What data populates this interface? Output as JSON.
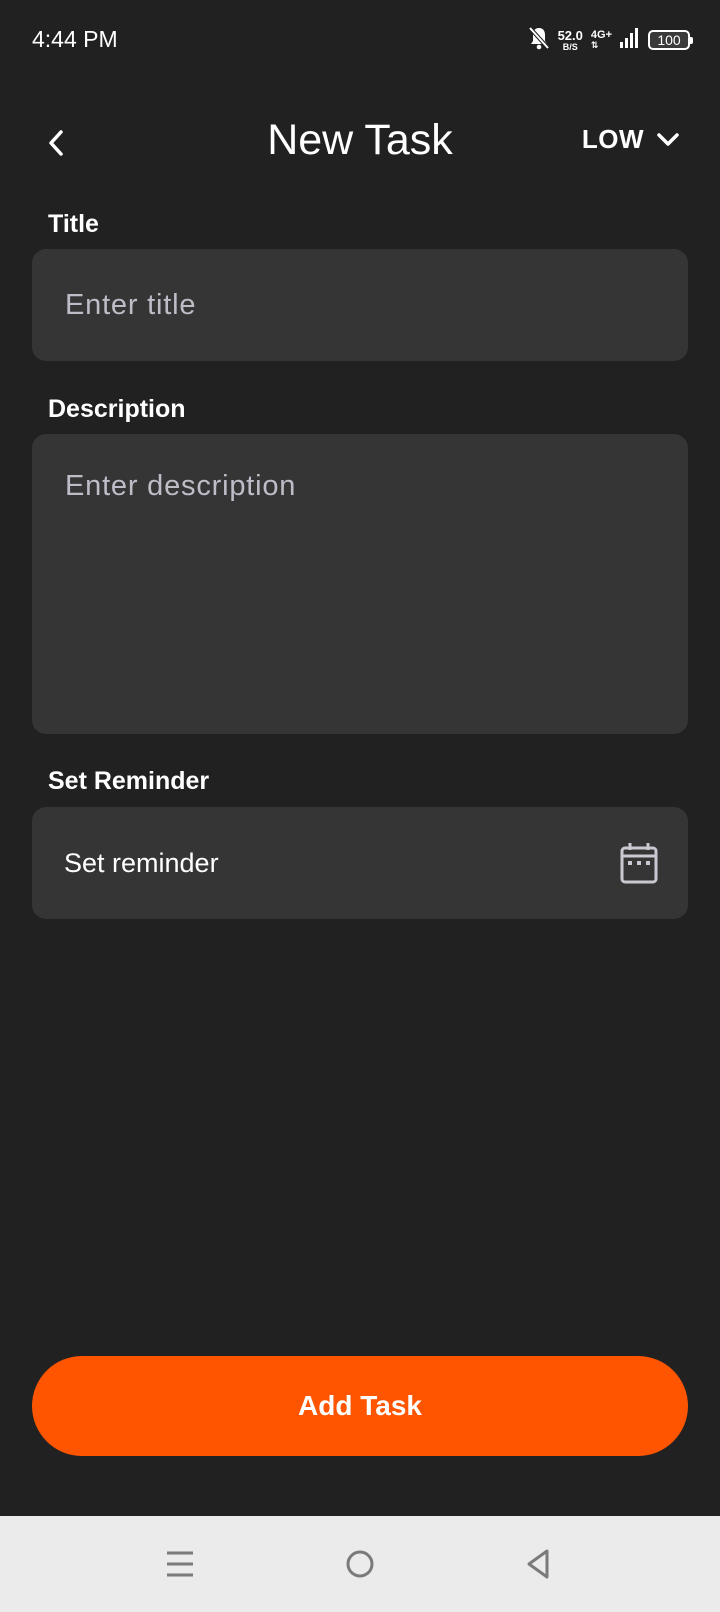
{
  "status_bar": {
    "time": "4:44 PM",
    "net_speed_value": "52.0",
    "net_speed_unit": "B/S",
    "network_type": "4G+",
    "battery_level": "100",
    "icons": [
      "bell-muted-icon",
      "signal-icon",
      "battery-icon"
    ]
  },
  "header": {
    "title": "New Task",
    "back_icon": "chevron-left-icon",
    "priority": {
      "selected": "LOW",
      "icon": "chevron-down-icon"
    }
  },
  "form": {
    "title": {
      "label": "Title",
      "value": "",
      "placeholder": "Enter title"
    },
    "description": {
      "label": "Description",
      "value": "",
      "placeholder": "Enter description"
    },
    "reminder": {
      "label": "Set Reminder",
      "value": "Set reminder",
      "icon": "calendar-icon"
    }
  },
  "actions": {
    "add_task_label": "Add Task",
    "accent_color": "#ff5500"
  },
  "nav_bar": {
    "buttons": [
      "menu-icon",
      "home-icon",
      "back-triangle-icon"
    ]
  },
  "colors": {
    "background": "#212121",
    "field_background": "#353535",
    "placeholder": "#bdbdc8",
    "nav_background": "#ebebeb"
  }
}
